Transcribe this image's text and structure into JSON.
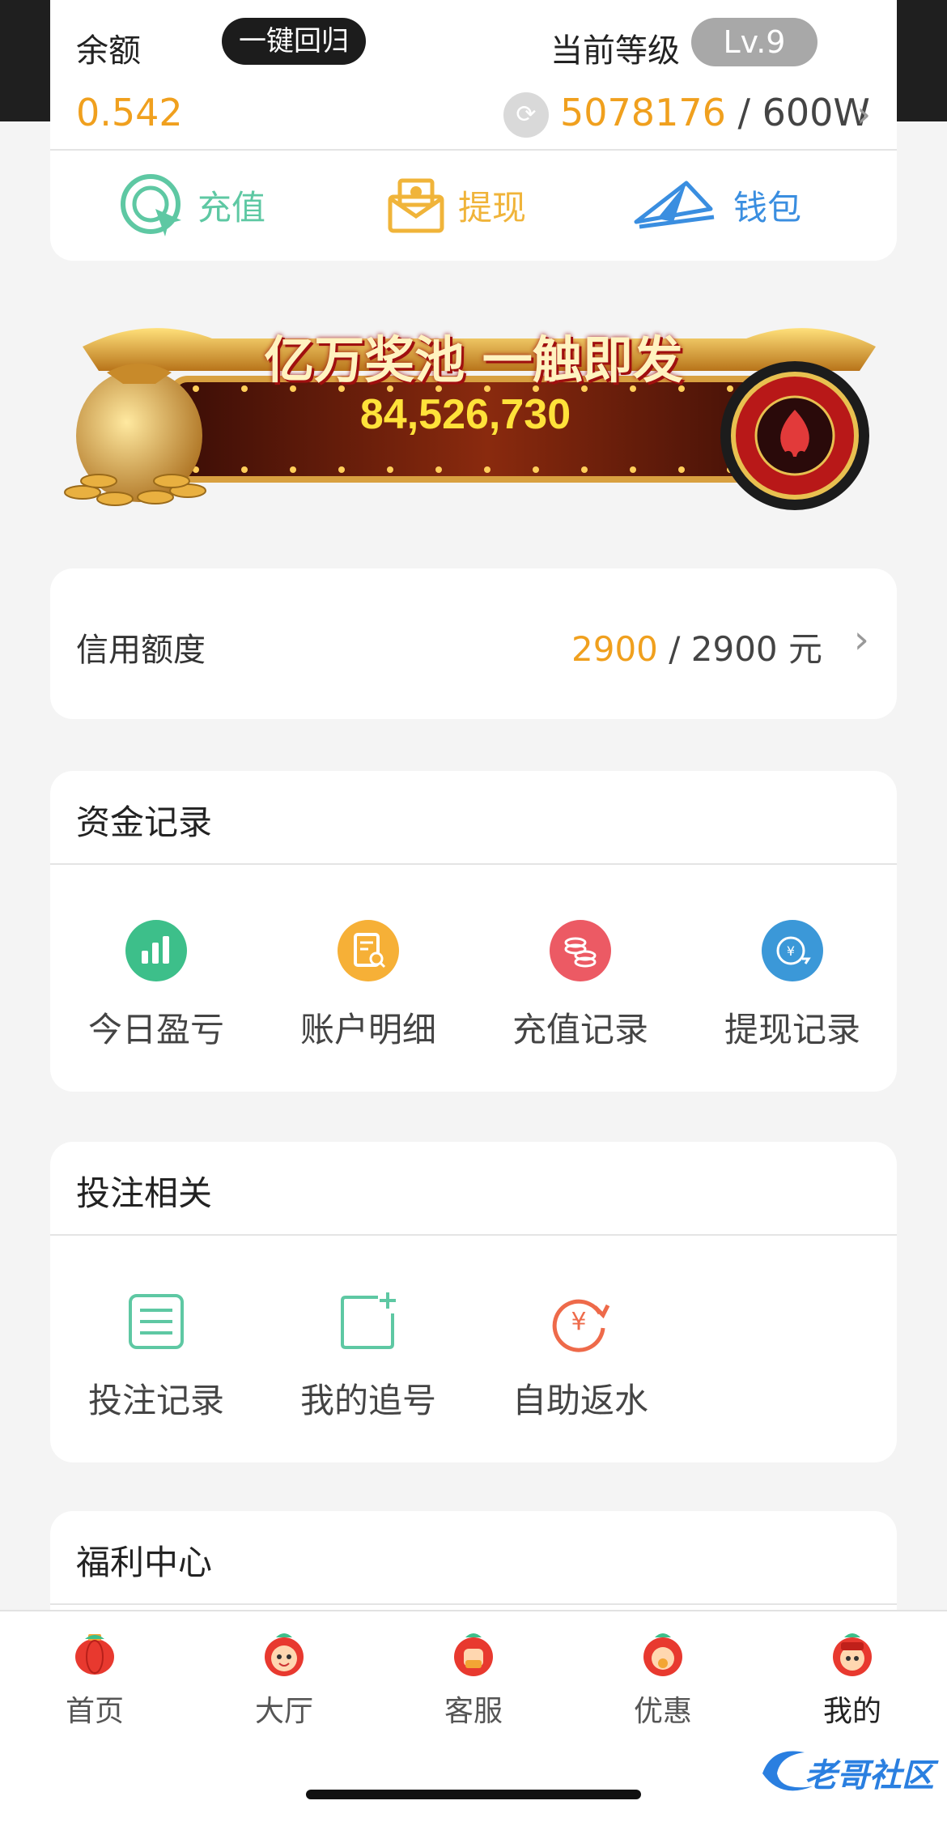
{
  "header": {
    "balance_label": "余额",
    "balance_value": "0.542",
    "recall_button": "一键回归",
    "level_label": "当前等级",
    "level_badge": "Lv.9",
    "exp_current": "5078176",
    "exp_sep": " / ",
    "exp_target": "600W"
  },
  "actions": [
    {
      "label": "充值",
      "icon": "recharge-icon",
      "color": "#5ec8a3"
    },
    {
      "label": "提现",
      "icon": "withdraw-envelope-icon",
      "color": "#f0b43a"
    },
    {
      "label": "钱包",
      "icon": "wallet-plane-icon",
      "color": "#3a8ee0"
    }
  ],
  "banner": {
    "title": "亿万奖池 一触即发",
    "jackpot": "84,526,730"
  },
  "credit": {
    "label": "信用额度",
    "used": "2900",
    "sep": " / ",
    "total": "2900 元"
  },
  "fund_records": {
    "title": "资金记录",
    "items": [
      {
        "label": "今日盈亏",
        "icon": "bar-chart-icon",
        "color": "#3dbf8a"
      },
      {
        "label": "账户明细",
        "icon": "document-search-icon",
        "color": "#f6b037"
      },
      {
        "label": "充值记录",
        "icon": "coins-icon",
        "color": "#ec5a64"
      },
      {
        "label": "提现记录",
        "icon": "yuan-exchange-icon",
        "color": "#3b98d8"
      }
    ]
  },
  "bet_related": {
    "title": "投注相关",
    "items": [
      {
        "label": "投注记录",
        "icon": "list-icon",
        "color": "#5ec8a3"
      },
      {
        "label": "我的追号",
        "icon": "add-note-icon",
        "color": "#5ec8a3"
      },
      {
        "label": "自助返水",
        "icon": "yuan-refund-icon",
        "color": "#ee6a4a"
      }
    ]
  },
  "welfare": {
    "title": "福利中心"
  },
  "tabbar": [
    {
      "label": "首页",
      "icon": "home-lantern-icon"
    },
    {
      "label": "大厅",
      "icon": "hall-mascot-icon"
    },
    {
      "label": "客服",
      "icon": "service-mascot-icon"
    },
    {
      "label": "优惠",
      "icon": "promo-mascot-icon"
    },
    {
      "label": "我的",
      "icon": "profile-mascot-icon",
      "active": true
    }
  ],
  "watermark": "老哥社区"
}
